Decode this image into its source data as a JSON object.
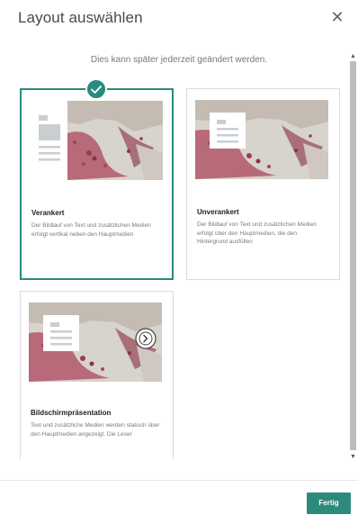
{
  "dialog": {
    "title": "Layout auswählen",
    "close_icon": "close-icon",
    "subtitle": "Dies kann später jederzeit geändert werden."
  },
  "layouts": [
    {
      "name": "Verankert",
      "description": "Der Bildlauf von Text und zusätzlichen Medien erfolgt vertikal neben den Hauptmedien",
      "selected": true
    },
    {
      "name": "Unverankert",
      "description": "Der Bildlauf von Text und zusätzlichen Medien erfolgt über den Hauptmedien, die den Hintergrund ausfüllen",
      "selected": false
    },
    {
      "name": "Bildschirmpräsentation",
      "description": "Text und zusätzliche Medien werden statisch über den Hauptmedien angezeigt. Die Leser",
      "selected": false
    }
  ],
  "footer": {
    "done_label": "Fertig"
  },
  "colors": {
    "accent": "#2b8a7f",
    "button": "#2e8b7c"
  }
}
